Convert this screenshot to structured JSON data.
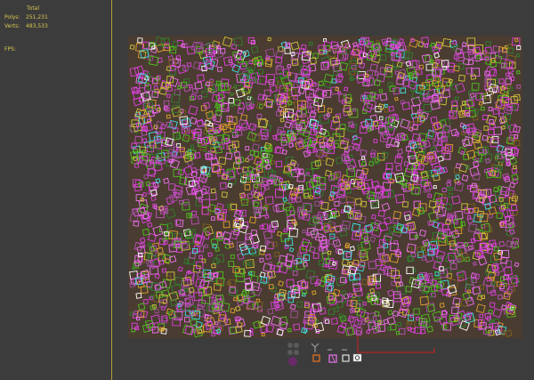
{
  "stats": {
    "header": "Total",
    "polys_label": "Polys:",
    "polys_value": "251,231",
    "verts_label": "Verts:",
    "verts_value": "483,533",
    "fps_label": "FPS:"
  },
  "colors": {
    "background": "#3c3c3c",
    "stats_text": "#d8c850",
    "divider": "#b0a030",
    "plane_fill": "#4a3c30",
    "particle_colors": [
      "#e040e0",
      "#c050c0",
      "#f070f0",
      "#50c020",
      "#308030",
      "#d0c040",
      "#e0a030",
      "#40e0e0",
      "#ffffff",
      "#a050a0",
      "#806020"
    ]
  },
  "icons": [
    "grid-plane-icon",
    "particle-box-icon",
    "transform-gizmo-icon",
    "emitter-icon",
    "camera-helper-icon"
  ]
}
